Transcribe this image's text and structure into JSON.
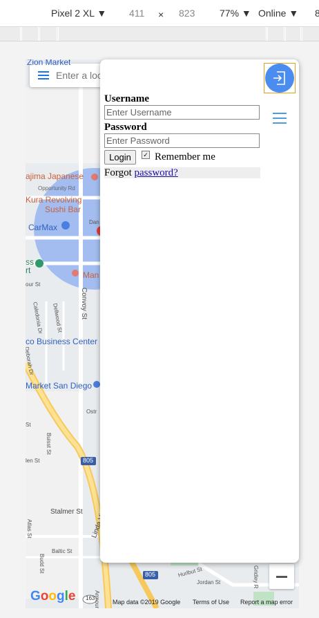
{
  "devtools": {
    "device": "Pixel 2 XL",
    "width": "411",
    "times": "×",
    "height": "823",
    "zoom": "77%",
    "network": "Online",
    "dropdown_arrow": "▼",
    "overflow": "8"
  },
  "map": {
    "search_placeholder": "Enter a loc",
    "labels": {
      "top_cut": "Zion Market",
      "hajima": "ajima Japanese",
      "opportunity": "Opportunity Rd",
      "kura1": "Kura Revolving",
      "kura2": "Sushi Bar",
      "carmax": "CarMax",
      "dan": "Dan",
      "sfront1": "ss",
      "sfront2": "rt",
      "man": "Man",
      "courst": "our St",
      "caledonia": "Caledonia Dr",
      "dellwood": "Dellwood St",
      "convoy": "Convoy St",
      "business": "co Business Center",
      "deborah": "Deborah Dr",
      "market": "Market San Diego",
      "ostr": "Ostr",
      "st1": "St",
      "buisst": "Buisst St",
      "len": "len St",
      "i805a": "805",
      "stalmer": "Stalmer St",
      "linda": "Linda Vi",
      "atlas": "Atlas St",
      "baltic": "Baltic St",
      "budd": "Budd St",
      "i805b": "805",
      "hurlbut": "Hurlbut St",
      "jordan": "Jordan St",
      "gridley": "Gridley R",
      "r163": "163",
      "armour": "Armour"
    },
    "google": "Google",
    "footer": {
      "data": "Map data ©2019 Google",
      "terms": "Terms of Use",
      "report": "Report a map error"
    }
  },
  "login": {
    "username_label": "Username",
    "username_placeholder": "Enter Username",
    "password_label": "Password",
    "password_placeholder": "Enter Password",
    "login_button": "Login",
    "remember_checked": "✓",
    "remember_label": "Remember me",
    "forgot_text": "Forgot ",
    "forgot_link": "password?"
  }
}
